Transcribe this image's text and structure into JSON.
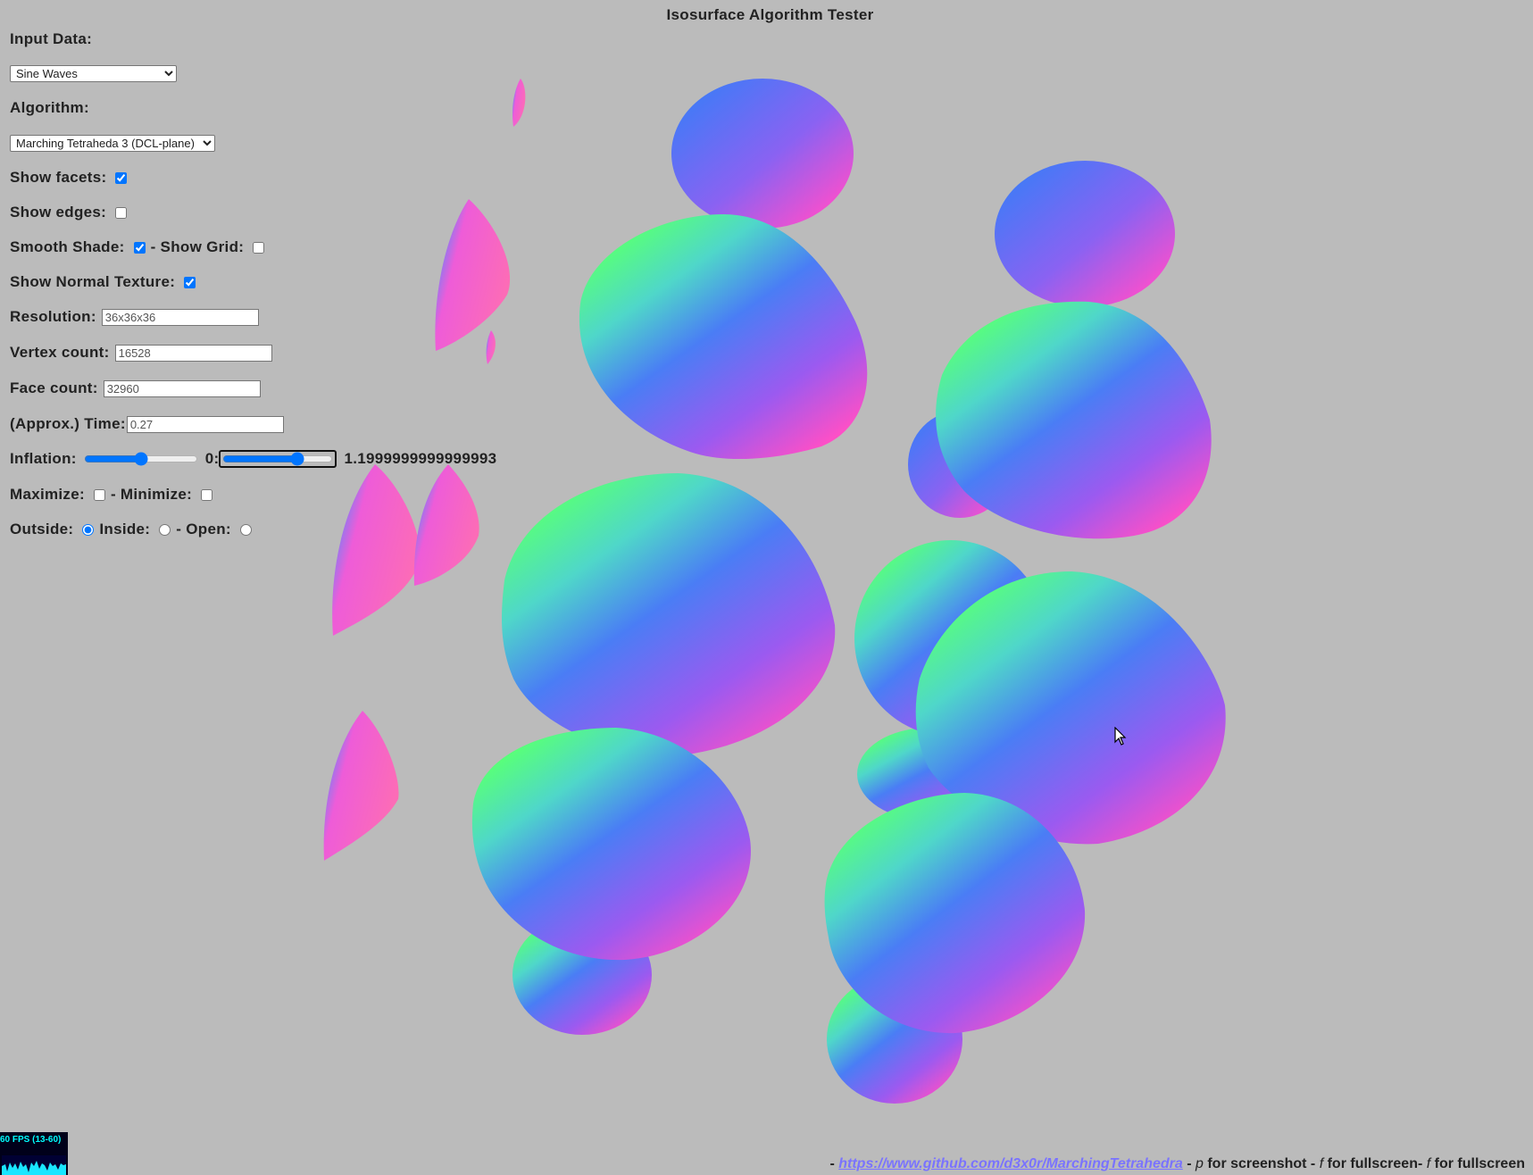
{
  "app": {
    "title": "Isosurface Algorithm Tester"
  },
  "controls": {
    "input_data": {
      "label": "Input Data:",
      "selected": "Sine Waves"
    },
    "algorithm": {
      "label": "Algorithm:",
      "selected": "Marching Tetraheda 3 (DCL-plane)"
    },
    "show_facets": {
      "label": "Show facets:",
      "checked": true
    },
    "show_edges": {
      "label": "Show edges:",
      "checked": false
    },
    "smooth_shade": {
      "label": "Smooth Shade:",
      "checked": true
    },
    "show_grid": {
      "label": "- Show Grid:",
      "checked": false
    },
    "show_normal_texture": {
      "label": "Show Normal Texture:",
      "checked": true
    },
    "resolution": {
      "label": "Resolution:",
      "value": "36x36x36"
    },
    "vertex_count": {
      "label": "Vertex count:",
      "value": "16528"
    },
    "face_count": {
      "label": "Face count:",
      "value": "32960"
    },
    "time": {
      "label": "(Approx.) Time:",
      "value": "0.27"
    },
    "inflation": {
      "label": "Inflation:",
      "slider1_level": 0.5,
      "zero_label": "0:",
      "slider2_level": 0.7,
      "value_text": "1.1999999999999993"
    },
    "maximize": {
      "label": "Maximize:",
      "checked": false
    },
    "minimize": {
      "label": "- Minimize:",
      "checked": false
    },
    "outside": {
      "label": "Outside:",
      "checked": true
    },
    "inside": {
      "label": "Inside:",
      "checked": false
    },
    "open": {
      "label": "- Open:",
      "checked": false
    }
  },
  "footer": {
    "prefix": "- ",
    "link": "https://www.github.com/d3x0r/MarchingTetrahedra",
    "sep1": " - ",
    "key_p": "p",
    "text_screenshot": " for screenshot - ",
    "key_f1": "f",
    "text_fullscreen1": " for fullscreen- ",
    "key_f2": "f",
    "text_fullscreen2": " for fullscreen"
  },
  "fps_meter": {
    "text": "60 FPS (13-60)"
  },
  "colors": {
    "background": "#bbbbbb",
    "link": "#7a73ff",
    "accent": "#0075ff"
  }
}
